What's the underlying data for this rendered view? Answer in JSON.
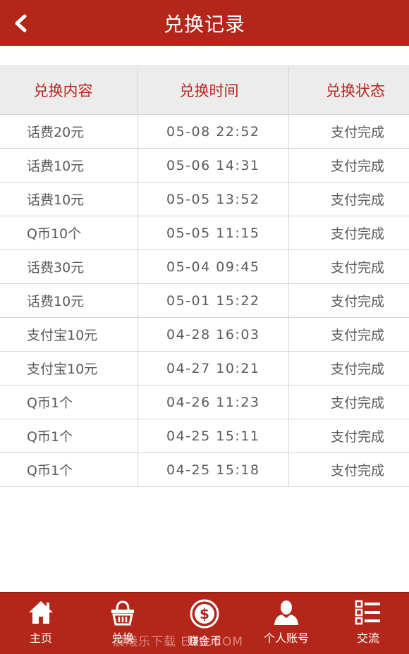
{
  "header": {
    "title": "兑换记录",
    "back_icon": "chevron-left-icon"
  },
  "table": {
    "columns": [
      "兑换内容",
      "兑换时间",
      "兑换状态"
    ],
    "rows": [
      {
        "content": "话费20元",
        "time": "05-08 22:52",
        "status": "支付完成"
      },
      {
        "content": "话费10元",
        "time": "05-06 14:31",
        "status": "支付完成"
      },
      {
        "content": "话费10元",
        "time": "05-05 13:52",
        "status": "支付完成"
      },
      {
        "content": "Q币10个",
        "time": "05-05 11:15",
        "status": "支付完成"
      },
      {
        "content": "话费30元",
        "time": "05-04 09:45",
        "status": "支付完成"
      },
      {
        "content": "话费10元",
        "time": "05-01 15:22",
        "status": "支付完成"
      },
      {
        "content": "支付宝10元",
        "time": "04-28 16:03",
        "status": "支付完成"
      },
      {
        "content": "支付宝10元",
        "time": "04-27 10:21",
        "status": "支付完成"
      },
      {
        "content": "Q币1个",
        "time": "04-26 11:23",
        "status": "支付完成"
      },
      {
        "content": "Q币1个",
        "time": "04-25 15:11",
        "status": "支付完成"
      },
      {
        "content": "Q币1个",
        "time": "04-25 15:18",
        "status": "支付完成"
      }
    ]
  },
  "bottom_nav": {
    "items": [
      {
        "label": "主页",
        "icon": "home-icon"
      },
      {
        "label": "兑换",
        "icon": "basket-icon"
      },
      {
        "label": "赚金币",
        "icon": "dollar-coin-icon"
      },
      {
        "label": "个人账号",
        "icon": "user-icon"
      },
      {
        "label": "交流",
        "icon": "list-icon"
      }
    ]
  },
  "watermark": "晨曦乐下载  EDU.COM",
  "colors": {
    "brand": "#b5261a",
    "header_text": "#ffffff",
    "table_header_bg": "#ececec",
    "table_header_text": "#b5261a",
    "cell_text": "#5a5a5a",
    "border": "#d6d6d6"
  }
}
